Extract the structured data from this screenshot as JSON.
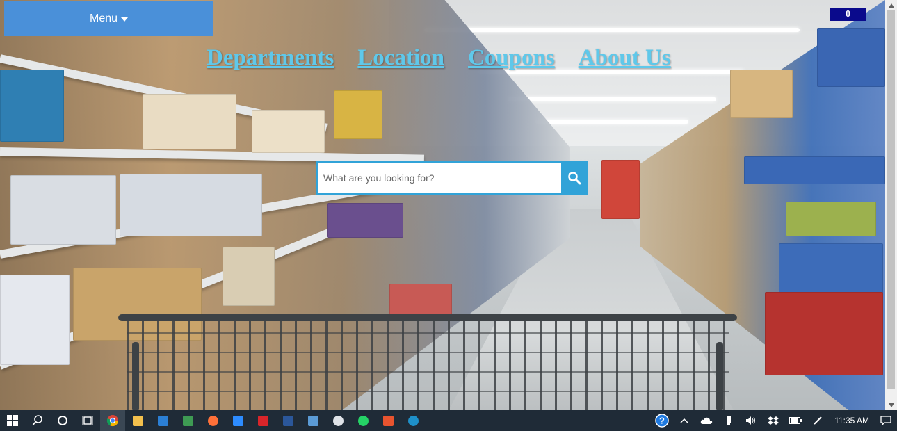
{
  "menu": {
    "label": "Menu"
  },
  "nav": [
    "Departments",
    "Location",
    "Coupons",
    "About Us"
  ],
  "cart": {
    "count": "0"
  },
  "search": {
    "placeholder": "What are you looking for?"
  },
  "taskbar": {
    "time": "11:35 AM"
  },
  "colors": {
    "menu": "#4a90d9",
    "nav_link": "#5fc8ea",
    "search_accent": "#31a3d8",
    "cart_badge": "#0a0a8c",
    "taskbar": "#1f2b37"
  }
}
